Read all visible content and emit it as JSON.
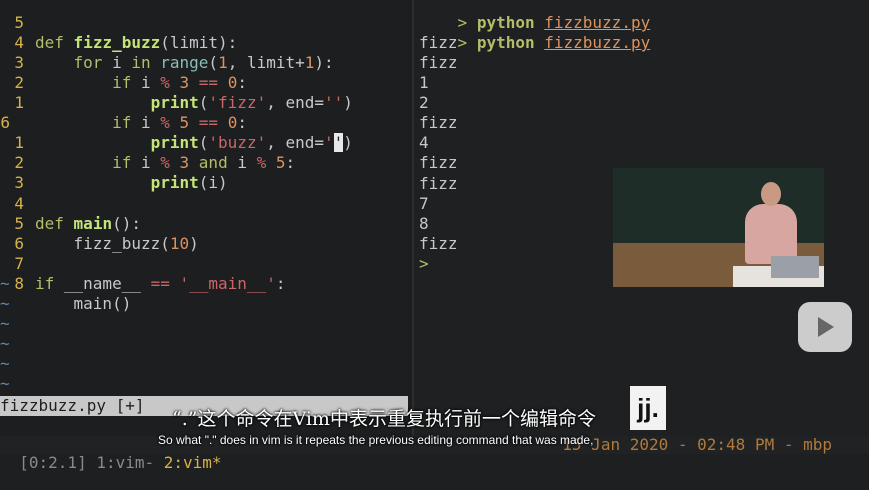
{
  "editor": {
    "lines": [
      {
        "num": "5",
        "code": "def fizz_buzz(limit):"
      },
      {
        "num": "4",
        "code": "    for i in range(1, limit+1):"
      },
      {
        "num": "3",
        "code": "        if i % 3 == 0:"
      },
      {
        "num": "2",
        "code": "            print('fizz', end='')"
      },
      {
        "num": "1",
        "code": "        if i % 5 == 0:"
      },
      {
        "num": "6",
        "code": "            print('buzz', end='')"
      },
      {
        "num": "1",
        "code": "        if i % 3 and i % 5:"
      },
      {
        "num": "2",
        "code": "            print(i)"
      },
      {
        "num": "3",
        "code": ""
      },
      {
        "num": "4",
        "code": "def main():"
      },
      {
        "num": "5",
        "code": "    fizz_buzz(10)"
      },
      {
        "num": "6",
        "code": ""
      },
      {
        "num": "7",
        "code": "if __name__ == '__main__':"
      },
      {
        "num": "8",
        "code": "    main()"
      }
    ],
    "tilde": "~",
    "status_file": "fizzbuzz.py [+]"
  },
  "terminal": {
    "prompt": ">",
    "command": "python",
    "file": "fizzbuzz.py",
    "output": [
      "fizz",
      "fizz",
      "1",
      "2",
      "fizz",
      "4",
      "fizz",
      "fizz",
      "7",
      "8",
      "fizz"
    ]
  },
  "tmux": {
    "left": "[0:2.1] 1:vim- ",
    "current": "2:vim*",
    "right": "15 Jan 2020 - 02:48 PM - mbp"
  },
  "subtitles": {
    "cn": "“.”这个命令在Vim中表示重复执行前一个编辑命令",
    "en": "So what \".\" does in vim is it repeats the previous editing command that was made,"
  },
  "watermark": {
    "text": "jj."
  },
  "colors": {
    "accent": "#b5bd68",
    "line_number": "#d6b24a",
    "tilde": "#5f87af"
  }
}
